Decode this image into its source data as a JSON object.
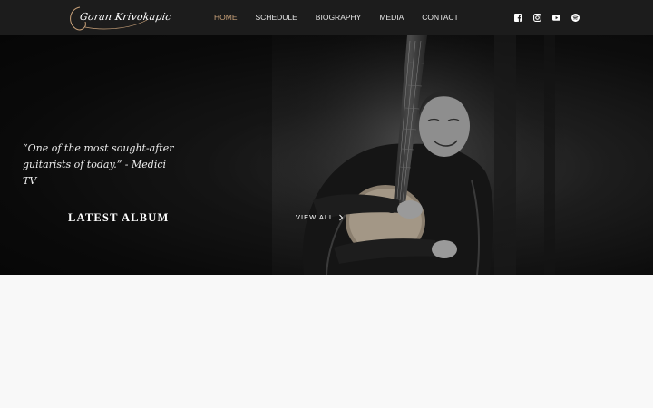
{
  "header": {
    "logo_text": "Goran Krivokapic",
    "nav": [
      {
        "label": "HOME",
        "active": true
      },
      {
        "label": "SCHEDULE",
        "active": false
      },
      {
        "label": "BIOGRAPHY",
        "active": false
      },
      {
        "label": "MEDIA",
        "active": false
      },
      {
        "label": "CONTACT",
        "active": false
      }
    ],
    "socials": [
      "facebook-icon",
      "instagram-icon",
      "youtube-icon",
      "spotify-icon"
    ]
  },
  "hero": {
    "quote": "“One of the most sought-after guitarists of today.” - Medici TV",
    "section_title": "LATEST ALBUM",
    "view_all_label": "VIEW ALL"
  },
  "colors": {
    "nav_background": "#1c1c1c",
    "active_link": "#c9a27a",
    "hero_background": "#0d0d0d",
    "page_background": "#f8f8f8"
  }
}
